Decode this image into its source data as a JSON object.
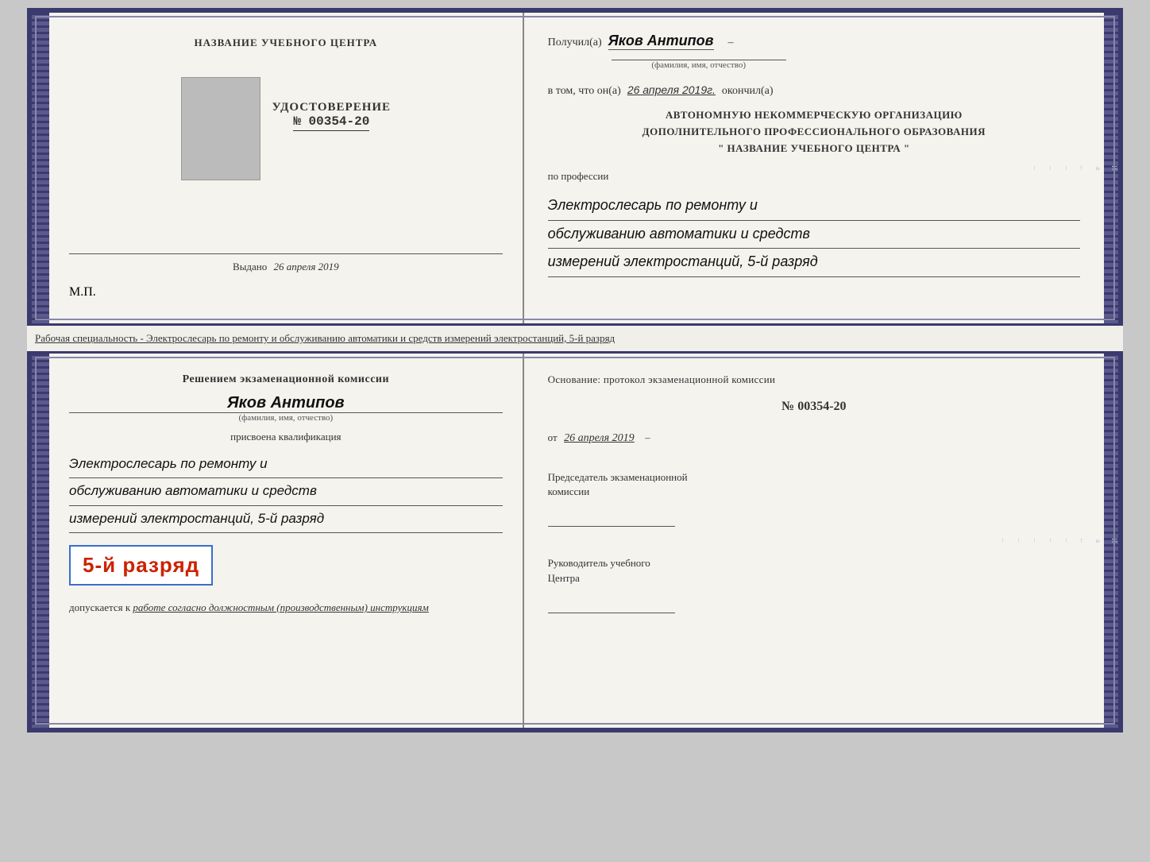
{
  "topDiploma": {
    "left": {
      "centerTitle": "НАЗВАНИЕ УЧЕБНОГО ЦЕНТРА",
      "udostoverenie": "УДОСТОВЕРЕНИЕ",
      "number": "№ 00354-20",
      "vydano": "Выдано",
      "vydanoDate": "26 апреля 2019",
      "mp": "М.П."
    },
    "right": {
      "poluchilLabel": "Получил(а)",
      "fioHandwritten": "Яков Антипов",
      "fioSubLabel": "(фамилия, имя, отчество)",
      "vtomLabel": "в том, что он(а)",
      "dateHandwritten": "26 апреля 2019г.",
      "okonchilLabel": "окончил(а)",
      "anoLine1": "АВТОНОМНУЮ НЕКОММЕРЧЕСКУЮ ОРГАНИЗАЦИЮ",
      "anoLine2": "ДОПОЛНИТЕЛЬНОГО ПРОФЕССИОНАЛЬНОГО ОБРАЗОВАНИЯ",
      "anoLine3": "\"   НАЗВАНИЕ УЧЕБНОГО ЦЕНТРА   \"",
      "poProfessii": "по профессии",
      "professiyaLine1": "Электрослесарь по ремонту и",
      "professiyaLine2": "обслуживанию автоматики и средств",
      "professiyaLine3": "измерений электростанций, 5-й разряд"
    }
  },
  "descriptionText": "Рабочая специальность - Электрослесарь по ремонту и обслуживанию автоматики и средств измерений электростанций, 5-й разряд",
  "bottomDiploma": {
    "left": {
      "resheniemText": "Решением экзаменационной комиссии",
      "fioHandwritten": "Яков Антипов",
      "fioSubLabel": "(фамилия, имя, отчество)",
      "prisvoenaText": "присвоена квалификация",
      "qualLine1": "Электрослесарь по ремонту и",
      "qualLine2": "обслуживанию автоматики и средств",
      "qualLine3": "измерений электростанций, 5-й разряд",
      "razryadBig": "5-й разряд",
      "dopuskaetsyaText": "допускается к",
      "dopuskaetsyaItalic": "работе согласно должностным (производственным) инструкциям"
    },
    "right": {
      "osnovanieLine": "Основание: протокол экзаменационной комиссии",
      "numberLabel": "№  00354-20",
      "otLabel": "от",
      "otDate": "26 апреля 2019",
      "predsedatelLine1": "Председатель экзаменационной",
      "predsedatelLine2": "комиссии",
      "rukovoditelLine1": "Руководитель учебного",
      "rukovoditelLine2": "Центра"
    }
  },
  "rightStripLetters": [
    "И",
    "а",
    "←",
    "–",
    "–",
    "–",
    "–",
    "–"
  ]
}
